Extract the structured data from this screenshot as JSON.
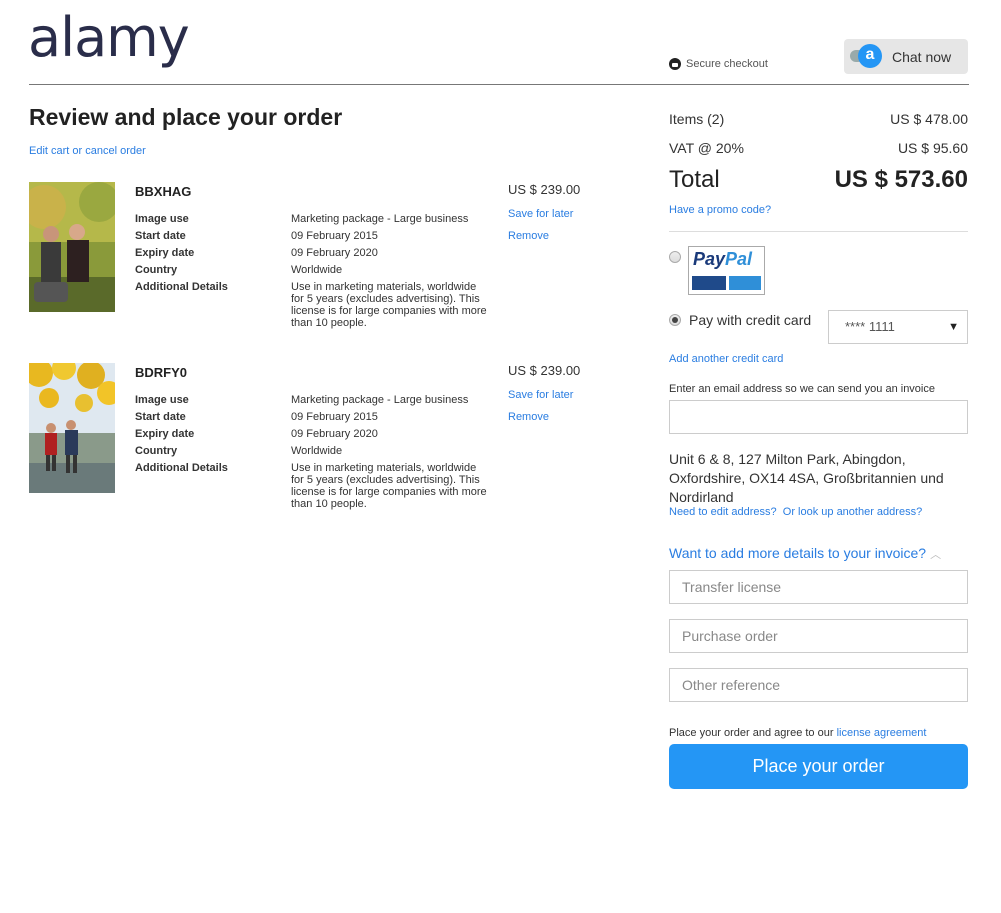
{
  "header": {
    "logo": "alamy",
    "secure_checkout": "Secure checkout",
    "chat_label": "Chat now",
    "chat_icon_letter": "a"
  },
  "page": {
    "title": "Review and place your order",
    "edit_link": "Edit cart or cancel order"
  },
  "labels": {
    "image_use": "Image use",
    "start_date": "Start date",
    "expiry_date": "Expiry date",
    "country": "Country",
    "additional_details": "Additional Details",
    "save_for_later": "Save for later",
    "remove": "Remove"
  },
  "items": [
    {
      "code": "BBXHAG",
      "price": "US $ 239.00",
      "image_use": "Marketing package - Large business",
      "start_date": "09 February 2015",
      "expiry_date": "09 February 2020",
      "country": "Worldwide",
      "additional_details": "Use in marketing materials, worldwide for 5 years (excludes advertising). This license is for large companies with more than 10 people."
    },
    {
      "code": "BDRFY0",
      "price": "US $ 239.00",
      "image_use": "Marketing package - Large business",
      "start_date": "09 February 2015",
      "expiry_date": "09 February 2020",
      "country": "Worldwide",
      "additional_details": "Use in marketing materials, worldwide for 5 years (excludes advertising). This license is for large companies with more than 10 people."
    }
  ],
  "summary": {
    "items_label": "Items (2)",
    "items_value": "US $ 478.00",
    "vat_label": "VAT @ 20%",
    "vat_value": "US $ 95.60",
    "total_label": "Total",
    "total_value": "US $ 573.60",
    "promo_link": "Have a promo code?"
  },
  "payment": {
    "paypal_pay": "Pay",
    "paypal_pal": "Pal",
    "credit_card_label": "Pay with credit card",
    "selected_card": "**** 1111",
    "add_card_link": "Add another credit card",
    "email_label": "Enter an email address so we can send you an invoice",
    "email_value": ""
  },
  "address": {
    "text": "Unit 6 & 8, 127 Milton Park, Abingdon, Oxfordshire, OX14 4SA, Großbritannien und Nordirland",
    "edit_link": "Need to edit address?",
    "lookup_link": "Or look up another address?"
  },
  "invoice_details": {
    "toggle_label": "Want to add more details to your invoice?",
    "transfer_license_placeholder": "Transfer license",
    "purchase_order_placeholder": "Purchase order",
    "other_reference_placeholder": "Other reference"
  },
  "place_order": {
    "agree_text": "Place your order and agree to our",
    "license_link": "license agreement",
    "button_label": "Place your order"
  },
  "colors": {
    "accent": "#2496f5",
    "link": "#2a7de1",
    "logo": "#2a2d4a"
  }
}
